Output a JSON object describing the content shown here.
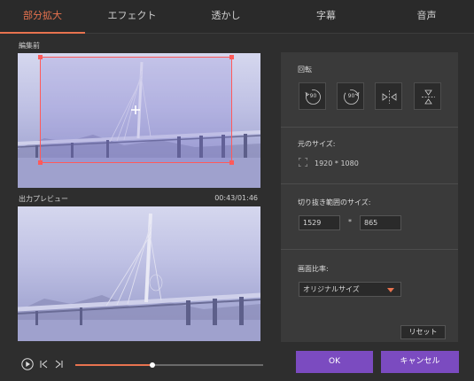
{
  "tabs": [
    "部分拡大",
    "エフェクト",
    "透かし",
    "字幕",
    "音声"
  ],
  "active_tab": 0,
  "preview": {
    "before_label": "編集前",
    "output_label": "出力プレビュー",
    "time": "00:43/01:46"
  },
  "panel": {
    "rotate_title": "回転",
    "rotate_buttons": {
      "left": {
        "label": "90",
        "icon": "rotate-left-icon"
      },
      "right": {
        "label": "90",
        "icon": "rotate-right-icon"
      },
      "flip_h": {
        "icon": "flip-horizontal-icon"
      },
      "flip_v": {
        "icon": "flip-vertical-icon"
      }
    },
    "original_size_title": "元のサイズ:",
    "original_size_value": "1920 * 1080",
    "crop_size_title": "切り抜き範囲のサイズ:",
    "crop_width": "1529",
    "crop_times": "*",
    "crop_height": "865",
    "aspect_title": "画面比率:",
    "aspect_value": "オリジナルサイズ",
    "reset_label": "リセット"
  },
  "playback": {
    "progress_fraction": 0.41
  },
  "buttons": {
    "ok": "OK",
    "cancel": "キャンセル"
  },
  "colors": {
    "accent": "#e8734f",
    "primary_button": "#7b4bc0",
    "crop_border": "#ff5a5a"
  }
}
